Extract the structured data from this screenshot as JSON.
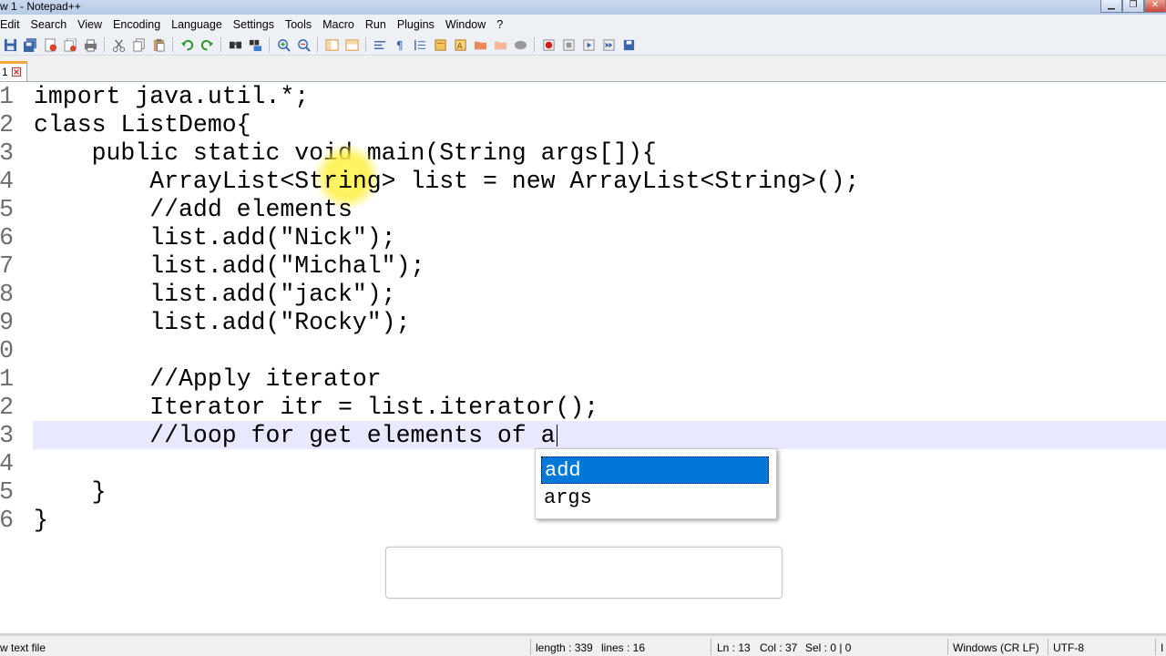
{
  "window": {
    "title": "w 1 - Notepad++",
    "buttons": {
      "minimize": "▁",
      "restore": "❐",
      "close": "✕"
    }
  },
  "menubar": {
    "items": [
      "Edit",
      "Search",
      "View",
      "Encoding",
      "Language",
      "Settings",
      "Tools",
      "Macro",
      "Run",
      "Plugins",
      "Window",
      "?"
    ]
  },
  "toolbar": {
    "icons": [
      "save-icon",
      "save-all-icon",
      "close-icon",
      "close-all-icon",
      "print-icon",
      "cut-icon",
      "copy-icon",
      "paste-icon",
      "undo-icon",
      "redo-icon",
      "find-icon",
      "replace-icon",
      "zoom-in-icon",
      "zoom-out-icon",
      "sync-v-icon",
      "sync-h-icon",
      "wrap-icon",
      "show-all-chars-icon",
      "indent-guide-icon",
      "doc-map-icon",
      "function-list-icon",
      "folder-icon",
      "monitor-icon",
      "record-macro-icon",
      "stop-macro-icon",
      "play-macro-icon",
      "run-macro-multiple-icon",
      "save-macro-icon"
    ]
  },
  "tab": {
    "label": "1",
    "accent": "#f5a43a"
  },
  "editor": {
    "lines": [
      {
        "num": "1",
        "text": "import java.util.*;"
      },
      {
        "num": "2",
        "text": "class ListDemo{"
      },
      {
        "num": "3",
        "text": "    public static void main(String args[]){"
      },
      {
        "num": "4",
        "text": "        ArrayList<String> list = new ArrayList<String>();"
      },
      {
        "num": "5",
        "text": "        //add elements"
      },
      {
        "num": "6",
        "text": "        list.add(\"Nick\");"
      },
      {
        "num": "7",
        "text": "        list.add(\"Michal\");"
      },
      {
        "num": "8",
        "text": "        list.add(\"jack\");"
      },
      {
        "num": "9",
        "text": "        list.add(\"Rocky\");"
      },
      {
        "num": "0",
        "text": ""
      },
      {
        "num": "1",
        "text": "        //Apply iterator"
      },
      {
        "num": "2",
        "text": "        Iterator itr = list.iterator();"
      },
      {
        "num": "3",
        "text": "        //loop for get elements of a"
      },
      {
        "num": "4",
        "text": ""
      },
      {
        "num": "5",
        "text": "    }"
      },
      {
        "num": "6",
        "text": "}"
      }
    ],
    "current_line_color": "#e8e8ff"
  },
  "autocomplete": {
    "items": [
      "add",
      "args"
    ],
    "selected_index": 0,
    "selected_color": "#0078d7"
  },
  "statusbar": {
    "file_type": "w text file",
    "length": "length : 339",
    "lines": "lines : 16",
    "position": "Ln : 13",
    "column": "Col : 37",
    "selection": "Sel : 0 | 0",
    "eol": "Windows (CR LF)",
    "encoding": "UTF-8",
    "mode": "I"
  }
}
